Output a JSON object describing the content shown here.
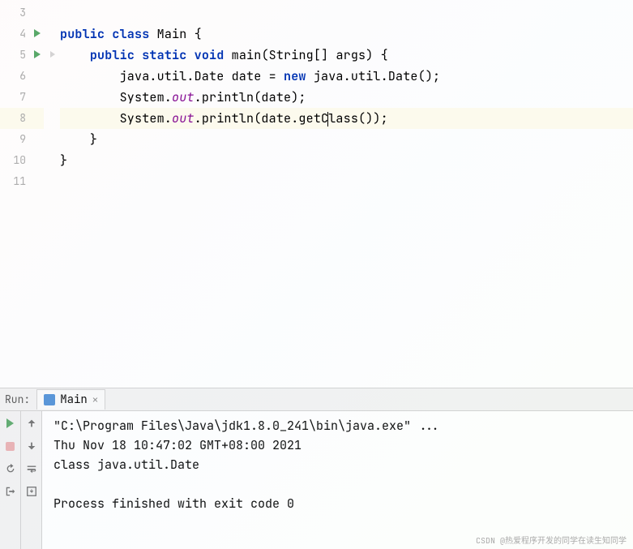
{
  "gutter": {
    "lines": [
      "3",
      "4",
      "5",
      "6",
      "7",
      "8",
      "9",
      "10",
      "11"
    ]
  },
  "code": {
    "l4": {
      "indent": "",
      "kw1": "public",
      "kw2": "class",
      "name": "Main",
      "brace": " {"
    },
    "l5": {
      "indent": "    ",
      "kw1": "public",
      "kw2": "static",
      "kw3": "void",
      "name": "main",
      "params": "(String[] args) {"
    },
    "l6": {
      "indent": "        ",
      "t1": "java.util.Date date = ",
      "kw": "new",
      "t2": " java.util.Date();"
    },
    "l7": {
      "indent": "        ",
      "t1": "System.",
      "f": "out",
      "t2": ".println(date);"
    },
    "l8": {
      "indent": "        ",
      "t1": "System.",
      "f": "out",
      "t2": ".println(date.getC",
      "t3": "lass());"
    },
    "l9": {
      "indent": "    ",
      "t": "}"
    },
    "l10": {
      "indent": "",
      "t": "}"
    }
  },
  "run": {
    "label": "Run:",
    "tab": "Main"
  },
  "console": {
    "cmd": "\"C:\\Program Files\\Java\\jdk1.8.0_241\\bin\\java.exe\" ...",
    "out1": "Thu Nov 18 10:47:02 GMT+08:00 2021",
    "out2": "class java.util.Date",
    "exit": "Process finished with exit code 0"
  },
  "watermark": "CSDN @热爱程序开发的同学在读生知同学"
}
